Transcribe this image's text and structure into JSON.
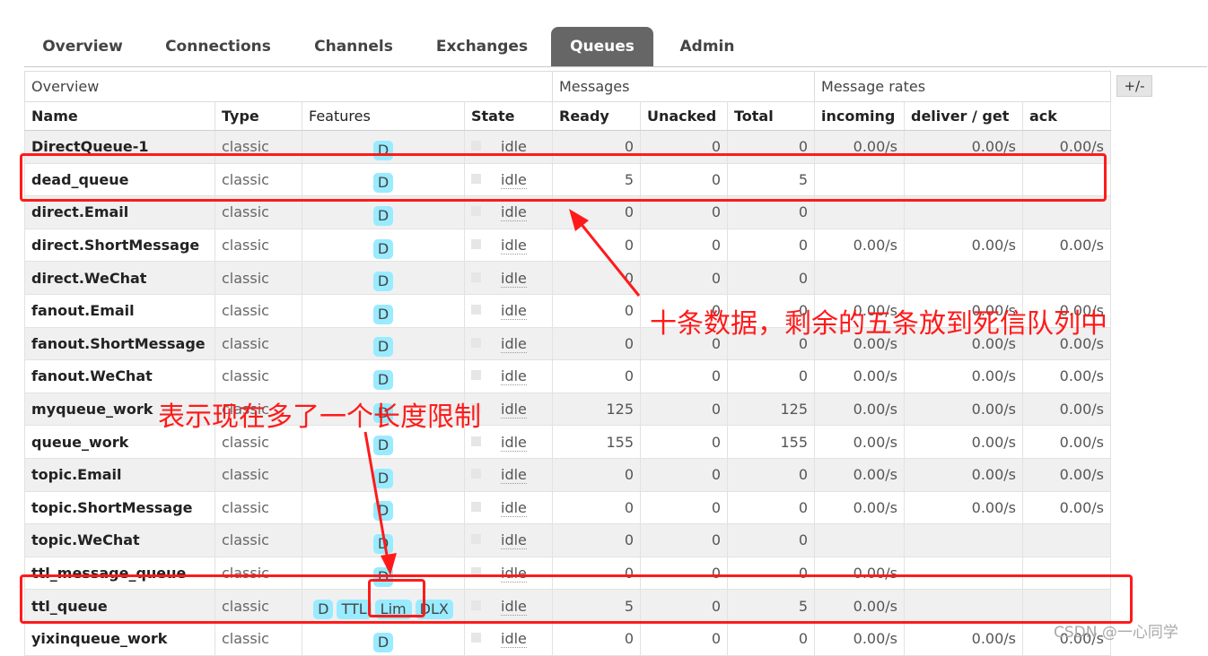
{
  "tabs": [
    {
      "label": "Overview",
      "active": false
    },
    {
      "label": "Connections",
      "active": false
    },
    {
      "label": "Channels",
      "active": false
    },
    {
      "label": "Exchanges",
      "active": false
    },
    {
      "label": "Queues",
      "active": true
    },
    {
      "label": "Admin",
      "active": false
    }
  ],
  "toggle_columns_label": "+/-",
  "groups": {
    "overview": "Overview",
    "messages": "Messages",
    "message_rates": "Message rates"
  },
  "columns": {
    "name": "Name",
    "type": "Type",
    "features": "Features",
    "state": "State",
    "ready": "Ready",
    "unacked": "Unacked",
    "total": "Total",
    "incoming": "incoming",
    "deliver_get": "deliver / get",
    "ack": "ack"
  },
  "queues": [
    {
      "name": "DirectQueue-1",
      "type": "classic",
      "features": [
        "D"
      ],
      "state": "idle",
      "ready": "0",
      "unacked": "0",
      "total": "0",
      "incoming": "0.00/s",
      "deliver_get": "0.00/s",
      "ack": "0.00/s"
    },
    {
      "name": "dead_queue",
      "type": "classic",
      "features": [
        "D"
      ],
      "state": "idle",
      "ready": "5",
      "unacked": "0",
      "total": "5",
      "incoming": "",
      "deliver_get": "",
      "ack": ""
    },
    {
      "name": "direct.Email",
      "type": "classic",
      "features": [
        "D"
      ],
      "state": "idle",
      "ready": "0",
      "unacked": "0",
      "total": "0",
      "incoming": "",
      "deliver_get": "",
      "ack": ""
    },
    {
      "name": "direct.ShortMessage",
      "type": "classic",
      "features": [
        "D"
      ],
      "state": "idle",
      "ready": "0",
      "unacked": "0",
      "total": "0",
      "incoming": "0.00/s",
      "deliver_get": "0.00/s",
      "ack": "0.00/s"
    },
    {
      "name": "direct.WeChat",
      "type": "classic",
      "features": [
        "D"
      ],
      "state": "idle",
      "ready": "0",
      "unacked": "0",
      "total": "0",
      "incoming": "",
      "deliver_get": "",
      "ack": ""
    },
    {
      "name": "fanout.Email",
      "type": "classic",
      "features": [
        "D"
      ],
      "state": "idle",
      "ready": "0",
      "unacked": "0",
      "total": "0",
      "incoming": "0.00/s",
      "deliver_get": "0.00/s",
      "ack": "0.00/s"
    },
    {
      "name": "fanout.ShortMessage",
      "type": "classic",
      "features": [
        "D"
      ],
      "state": "idle",
      "ready": "0",
      "unacked": "0",
      "total": "0",
      "incoming": "0.00/s",
      "deliver_get": "0.00/s",
      "ack": "0.00/s"
    },
    {
      "name": "fanout.WeChat",
      "type": "classic",
      "features": [
        "D"
      ],
      "state": "idle",
      "ready": "0",
      "unacked": "0",
      "total": "0",
      "incoming": "0.00/s",
      "deliver_get": "0.00/s",
      "ack": "0.00/s"
    },
    {
      "name": "myqueue_work",
      "type": "classic",
      "features": [
        "D"
      ],
      "state": "idle",
      "ready": "125",
      "unacked": "0",
      "total": "125",
      "incoming": "0.00/s",
      "deliver_get": "0.00/s",
      "ack": "0.00/s"
    },
    {
      "name": "queue_work",
      "type": "classic",
      "features": [
        "D"
      ],
      "state": "idle",
      "ready": "155",
      "unacked": "0",
      "total": "155",
      "incoming": "0.00/s",
      "deliver_get": "0.00/s",
      "ack": "0.00/s"
    },
    {
      "name": "topic.Email",
      "type": "classic",
      "features": [
        "D"
      ],
      "state": "idle",
      "ready": "0",
      "unacked": "0",
      "total": "0",
      "incoming": "0.00/s",
      "deliver_get": "0.00/s",
      "ack": "0.00/s"
    },
    {
      "name": "topic.ShortMessage",
      "type": "classic",
      "features": [
        "D"
      ],
      "state": "idle",
      "ready": "0",
      "unacked": "0",
      "total": "0",
      "incoming": "0.00/s",
      "deliver_get": "0.00/s",
      "ack": "0.00/s"
    },
    {
      "name": "topic.WeChat",
      "type": "classic",
      "features": [
        "D"
      ],
      "state": "idle",
      "ready": "0",
      "unacked": "0",
      "total": "0",
      "incoming": "",
      "deliver_get": "",
      "ack": ""
    },
    {
      "name": "ttl_message_queue",
      "type": "classic",
      "features": [
        "D"
      ],
      "state": "idle",
      "ready": "0",
      "unacked": "0",
      "total": "0",
      "incoming": "0.00/s",
      "deliver_get": "",
      "ack": ""
    },
    {
      "name": "ttl_queue",
      "type": "classic",
      "features": [
        "D",
        "TTL",
        "Lim",
        "DLX"
      ],
      "state": "idle",
      "ready": "5",
      "unacked": "0",
      "total": "5",
      "incoming": "0.00/s",
      "deliver_get": "",
      "ack": ""
    },
    {
      "name": "yixinqueue_work",
      "type": "classic",
      "features": [
        "D"
      ],
      "state": "idle",
      "ready": "0",
      "unacked": "0",
      "total": "0",
      "incoming": "0.00/s",
      "deliver_get": "0.00/s",
      "ack": "0.00/s"
    }
  ],
  "annotations": {
    "dead_letter_note": "十条数据，剩余的五条放到死信队列中",
    "length_limit_note": "表示现在多了一个长度限制"
  },
  "annotation_color": "#ff1a1a",
  "badge_color": "#99ebff",
  "active_tab_color": "#666666",
  "watermark": "CSDN @一心同学"
}
